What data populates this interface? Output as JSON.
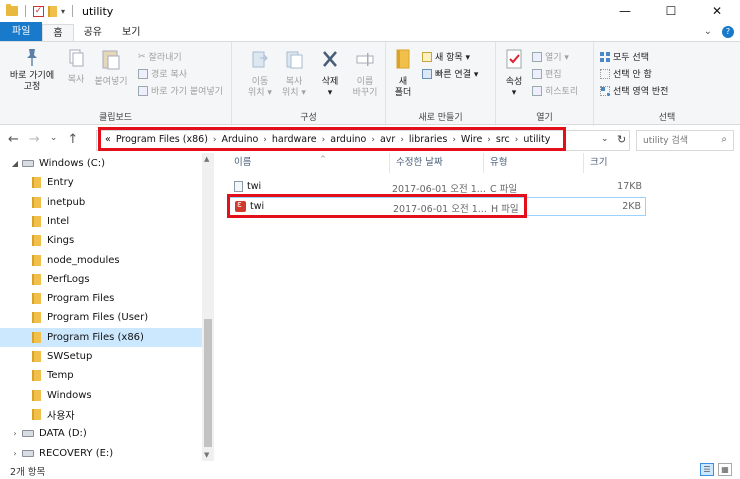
{
  "window": {
    "title": "utility",
    "controls": [
      "—",
      "☐",
      "✕"
    ]
  },
  "tabs": {
    "file": "파일",
    "home": "홈",
    "share": "공유",
    "view": "보기"
  },
  "ribbon": {
    "clipboard": {
      "label": "클립보드",
      "pin": "바로 가기에\n고정",
      "copy": "복사",
      "paste": "붙여넣기",
      "cut": "잘라내기",
      "copy_path": "경로 복사",
      "paste_shortcut": "바로 가기 붙여넣기"
    },
    "organize": {
      "label": "구성",
      "move_to": "이동\n위치 ▾",
      "copy_to": "복사\n위치 ▾",
      "delete": "삭제\n▾",
      "rename": "이름\n바꾸기"
    },
    "new": {
      "label": "새로 만들기",
      "new_folder": "새\n폴더",
      "new_item": "새 항목 ▾",
      "easy_access": "빠른 연결 ▾"
    },
    "open": {
      "label": "열기",
      "properties": "속성\n▾",
      "open": "열기 ▾",
      "edit": "편집",
      "history": "히스토리"
    },
    "select": {
      "label": "선택",
      "select_all": "모두 선택",
      "select_none": "선택 안 함",
      "invert": "선택 영역 반전"
    }
  },
  "nav": {
    "back": "←",
    "forward": "→",
    "recent": "⌄",
    "up": "↑"
  },
  "address": {
    "prefix": "«",
    "crumbs": [
      "Program Files (x86)",
      "Arduino",
      "hardware",
      "arduino",
      "avr",
      "libraries",
      "Wire",
      "src",
      "utility"
    ]
  },
  "search": {
    "placeholder": "utility 검색"
  },
  "tree": [
    {
      "label": "Windows (C:)",
      "type": "drive",
      "level": 1
    },
    {
      "label": "Entry",
      "type": "folder",
      "level": 2
    },
    {
      "label": "inetpub",
      "type": "folder",
      "level": 2
    },
    {
      "label": "Intel",
      "type": "folder",
      "level": 2
    },
    {
      "label": "Kings",
      "type": "folder",
      "level": 2
    },
    {
      "label": "node_modules",
      "type": "folder",
      "level": 2
    },
    {
      "label": "PerfLogs",
      "type": "folder",
      "level": 2
    },
    {
      "label": "Program Files",
      "type": "folder",
      "level": 2
    },
    {
      "label": "Program Files (User)",
      "type": "folder",
      "level": 2
    },
    {
      "label": "Program Files (x86)",
      "type": "folder",
      "level": 2,
      "selected": true
    },
    {
      "label": "SWSetup",
      "type": "folder",
      "level": 2
    },
    {
      "label": "Temp",
      "type": "folder",
      "level": 2
    },
    {
      "label": "Windows",
      "type": "folder",
      "level": 2
    },
    {
      "label": "사용자",
      "type": "folder",
      "level": 2
    },
    {
      "label": "DATA (D:)",
      "type": "drive",
      "level": 1
    },
    {
      "label": "RECOVERY (E:)",
      "type": "drive",
      "level": 1
    }
  ],
  "columns": {
    "name": "이름",
    "date": "수정한 날짜",
    "type": "유형",
    "size": "크기"
  },
  "files": [
    {
      "name": "twi",
      "date": "2017-06-01 오전 1...",
      "type": "C 파일",
      "size": "17KB",
      "icon": "c-file-icon"
    },
    {
      "name": "twi",
      "date": "2017-06-01 오전 1...",
      "type": "H 파일",
      "size": "2KB",
      "icon": "h-file-icon"
    }
  ],
  "status": {
    "count": "2개 항목"
  },
  "colors": {
    "accent": "#1979ca",
    "highlight_box": "#e3101c",
    "selection": "#cce8ff"
  }
}
